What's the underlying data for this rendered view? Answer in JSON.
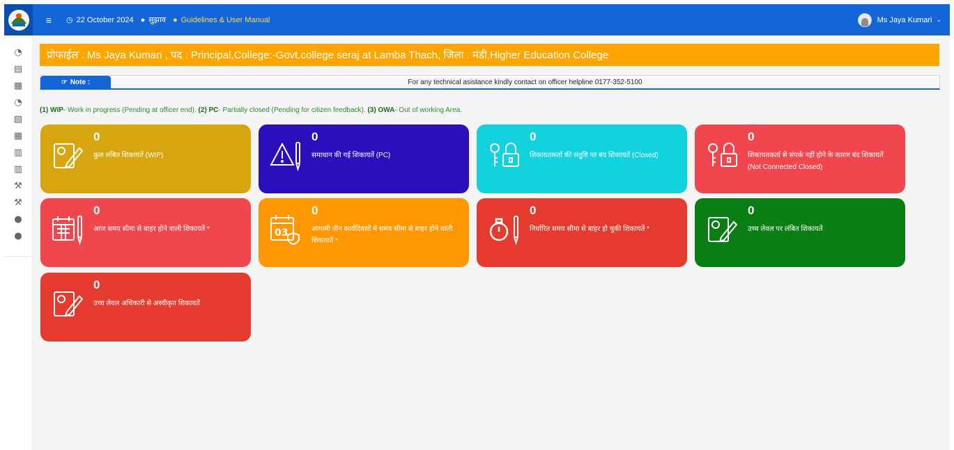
{
  "topbar": {
    "date": "22 October 2024",
    "suggestion": "सुझाव",
    "guidelines": "Guidelines & User Manual",
    "user_name": "Ms Jaya Kumari"
  },
  "profile": {
    "text": "प्रोफाईल : Ms Jaya Kumari , पद : Principal,College:-Govt.college seraj at Lamba Thach, जिला : मंडी,Higher Education College"
  },
  "note": {
    "label": "Note :",
    "text": "For any technical asistance kindly contact on officer helpline 0177-352-5100"
  },
  "legend": {
    "wip_key": "(1) WIP",
    "wip_text": "- Work in progress (Pending at officer end).",
    "pc_key": "(2) PC",
    "pc_text": "- Partially closed (Pending for citizen feedback).",
    "owa_key": "(3) OWA",
    "owa_text": "- Out of working Area."
  },
  "cards": [
    {
      "count": "0",
      "label": "कुल लंबित शिकायतें (WIP)",
      "color": "#d6a50f",
      "icon": "edit-document-icon"
    },
    {
      "count": "0",
      "label": "समाधान की गई शिकायतें (PC)",
      "color": "#2a0fbd",
      "icon": "warning-pen-icon"
    },
    {
      "count": "0",
      "label": "शिकायतकर्ता की संतुष्टि पर बंद शिकायतें (Closed)",
      "color": "#12d2dd",
      "icon": "key-lock-icon"
    },
    {
      "count": "0",
      "label": "शिकायतकर्ता से संपर्क नहीं होने के कारण बंद शिकायतें (Not Connected Closed)",
      "color": "#f2464f",
      "icon": "key-lock-icon"
    },
    {
      "count": "0",
      "label": "आज समय सीमा से बाहर होने वाली शिकायतें *",
      "color": "#f2464f",
      "icon": "calendar-pen-icon"
    },
    {
      "count": "0",
      "label": "आगामी तीन कार्यदिवसों में समय सीमा से बाहर होने वाली शिकायतें *",
      "color": "#ff9800",
      "icon": "calendar-03-icon"
    },
    {
      "count": "0",
      "label": "निर्धारित समय सीमा से बाहर हो चुकी शिकायतें *",
      "color": "#e53a30",
      "icon": "stopwatch-pen-icon"
    },
    {
      "count": "0",
      "label": "उच्च लेवल पर लंबित शिकायतें",
      "color": "#0a7d14",
      "icon": "edit-document-icon"
    },
    {
      "count": "0",
      "label": "उच्च लेवल अधिकारी से अस्वीकृत शिकायतें",
      "color": "#e53a30",
      "icon": "edit-document-icon"
    }
  ],
  "sidebar": {
    "icons": [
      "dashboard-icon",
      "clipboard-icon",
      "document-search-icon",
      "dashboard-icon",
      "document-edit-icon",
      "document-search-icon",
      "report-icon",
      "report-icon",
      "gavel-icon",
      "gavel-icon",
      "user-icon",
      "user-icon"
    ]
  }
}
